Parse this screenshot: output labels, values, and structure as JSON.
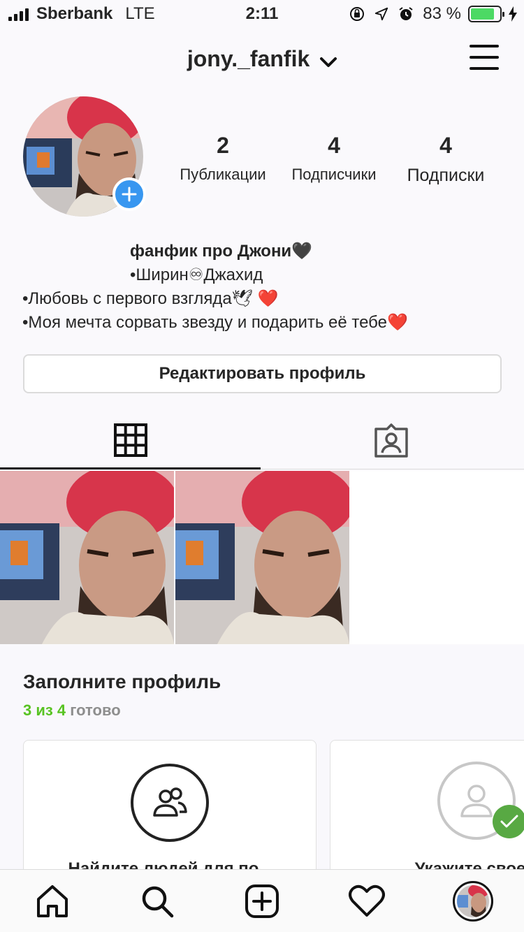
{
  "status_bar": {
    "carrier": "Sberbank",
    "network": "LTE",
    "time": "2:11",
    "battery_percent": "83 %",
    "battery_level": 0.83
  },
  "header": {
    "username": "jony._fanfik"
  },
  "profile": {
    "stats": [
      {
        "value": "2",
        "label": "Публикации"
      },
      {
        "value": "4",
        "label": "Подписчики"
      },
      {
        "value": "4",
        "label": "Подписки"
      }
    ],
    "bio": {
      "name": "фанфик про Джони🖤",
      "line1": "•Ширин♾Джахид",
      "line2": "•Любовь с первого взгляда🕊 ❤️",
      "line3": "•Моя мечта сорвать звезду и подарить её тебе❤️"
    },
    "edit_button": "Редактировать профиль"
  },
  "tabs": [
    {
      "icon": "grid-icon",
      "active": true
    },
    {
      "icon": "tagged-person-icon",
      "active": false
    }
  ],
  "complete_profile": {
    "title": "Заполните профиль",
    "progress_done": "3 из 4",
    "progress_rest": "готово",
    "cards": [
      {
        "icon": "people-icon",
        "label": "Найдите людей для по..."
      },
      {
        "icon": "profile-person-icon",
        "label": "Укажите свое..."
      }
    ]
  },
  "colors": {
    "accent_blue": "#3897f0",
    "success_green": "#58c322",
    "battery_green": "#4cd964"
  }
}
